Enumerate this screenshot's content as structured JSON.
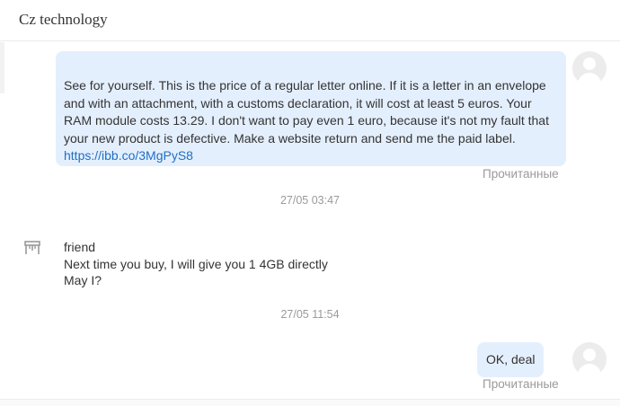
{
  "header": {
    "title": "Cz technology"
  },
  "messages": {
    "first": {
      "text": "See for yourself. This is the price of a regular letter online. If it is a letter in an envelope\nand with an attachment, with a customs declaration, it will cost at least 5 euros. Your\nRAM module costs 13.29. I don't want to pay even 1 euro, because it's not my fault that\nyour new product is defective. Make a website return and send me the paid label.",
      "link": "https://ibb.co/3MgPyS8",
      "status": "Прочитанные"
    },
    "time1": "27/05 03:47",
    "incoming": {
      "sender": "friend",
      "line1": "Next time you buy, I will give you 1 4GB directly",
      "line2": "May I?"
    },
    "time2": "27/05 11:54",
    "second": {
      "text": "OK, deal",
      "status": "Прочитанные"
    }
  },
  "icons": {
    "avatar": "user-avatar-icon",
    "shop": "shop-icon"
  }
}
